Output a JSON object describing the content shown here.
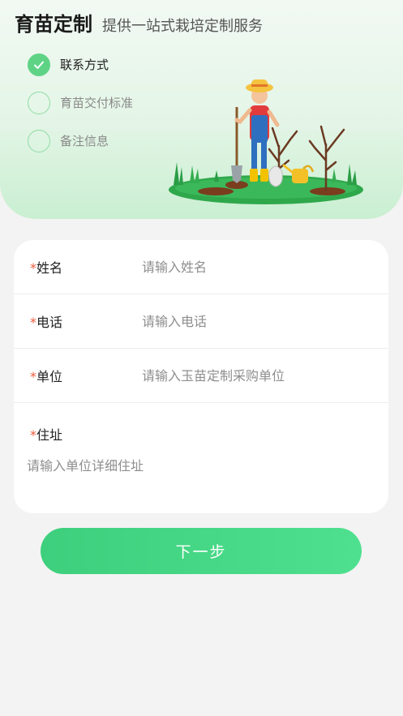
{
  "header": {
    "title": "育苗定制",
    "subtitle": "提供一站式栽培定制服务"
  },
  "steps": [
    {
      "label": "联系方式",
      "state": "done"
    },
    {
      "label": "育苗交付标准",
      "state": "pending"
    },
    {
      "label": "备注信息",
      "state": "pending"
    }
  ],
  "form": {
    "required_mark": "*",
    "fields": [
      {
        "label": "姓名",
        "placeholder": "请输入姓名"
      },
      {
        "label": "电话",
        "placeholder": "请输入电话"
      },
      {
        "label": "单位",
        "placeholder": "请输入玉苗定制采购单位"
      }
    ],
    "address": {
      "label": "住址",
      "placeholder": "请输入单位详细住址"
    }
  },
  "next_button": {
    "label": "下一步"
  },
  "colors": {
    "accent": "#4cd98a",
    "required": "#f05a3a",
    "hero_bg": "#e4f5e7"
  },
  "icons": {
    "step_done": "check-icon",
    "illustration": "gardener-illustration"
  }
}
